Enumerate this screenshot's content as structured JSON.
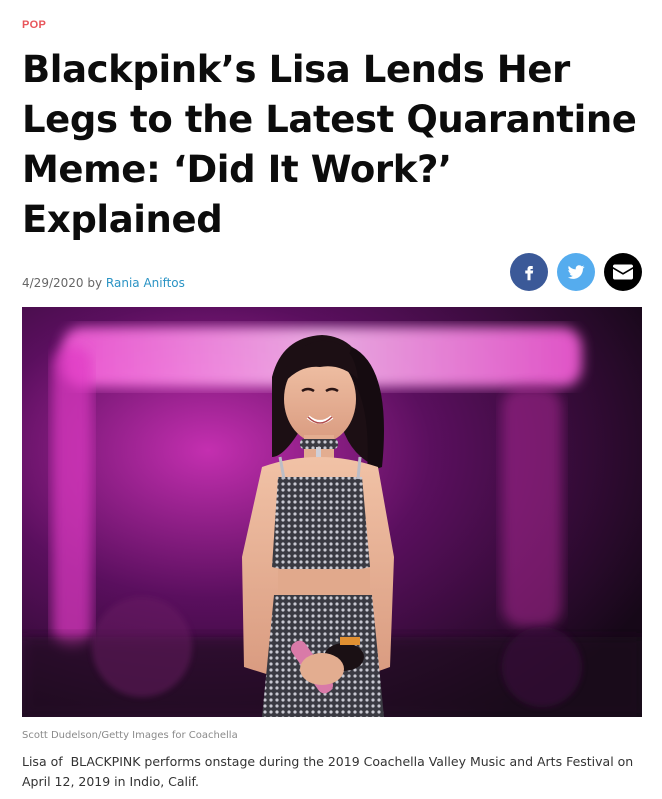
{
  "article": {
    "category": "POP",
    "headline_lines": [
      "Blackpink’s Lisa Lends Her",
      "Legs to the Latest Quarantine",
      "Meme: ‘Did It Work?’",
      "Explained"
    ],
    "date": "4/29/2020",
    "by_label": "by",
    "author": "Rania Aniftos",
    "photo_credit": "Scott Dudelson/Getty Images for Coachella",
    "caption": "Lisa of  BLACKPINK performs onstage during the 2019 Coachella Valley Music and Arts Festival on April 12, 2019 in Indio, Calif."
  },
  "share": [
    {
      "name": "facebook",
      "icon": "facebook-icon",
      "color": "#3b5998"
    },
    {
      "name": "twitter",
      "icon": "twitter-icon",
      "color": "#55acee"
    },
    {
      "name": "email",
      "icon": "email-icon",
      "color": "#000000"
    }
  ],
  "colors": {
    "category": "#e8555a",
    "author_link": "#2a93c4",
    "headline": "#0c0c0c"
  }
}
